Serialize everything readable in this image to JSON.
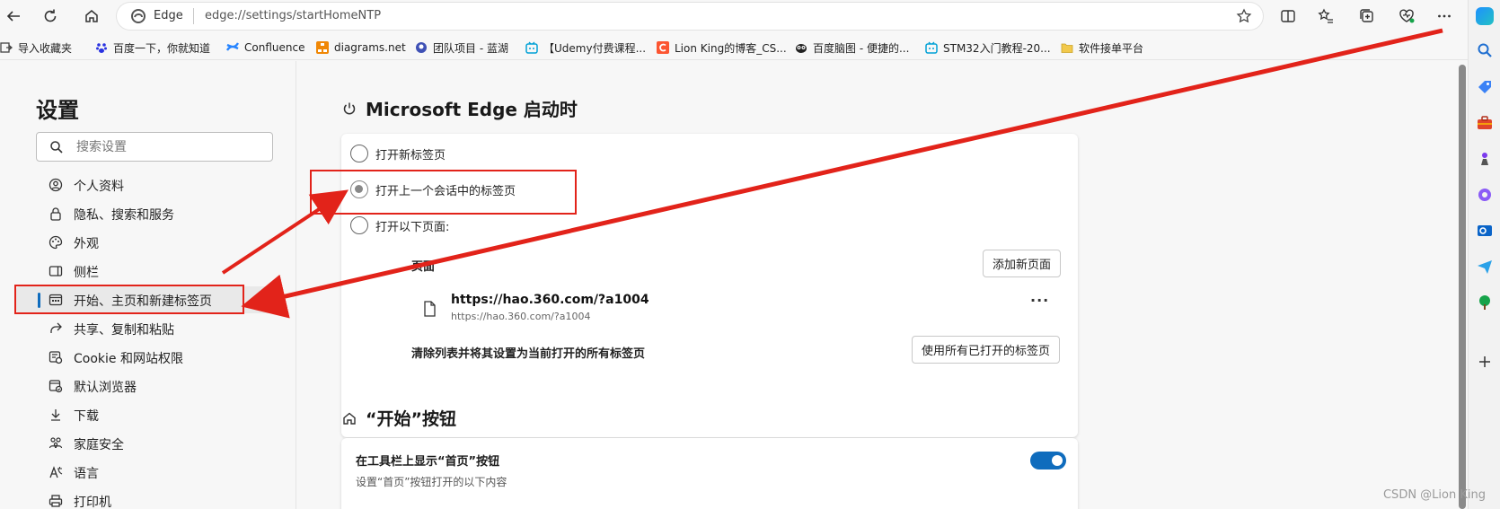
{
  "toolbar": {
    "address_site": "Edge",
    "address_url": "edge://settings/startHomeNTP"
  },
  "favorites": [
    {
      "label": "导入收藏夹",
      "icon": "import-icon",
      "color": "#444444"
    },
    {
      "label": "百度一下，你就知道",
      "icon": "baidu-icon",
      "color": "#2932e1"
    },
    {
      "label": "Confluence",
      "icon": "confluence-icon",
      "color": "#2684ff"
    },
    {
      "label": "diagrams.net",
      "icon": "diagrams-icon",
      "color": "#f08705"
    },
    {
      "label": "团队项目 - 蓝湖",
      "icon": "lanhu-icon",
      "color": "#3f51b5"
    },
    {
      "label": "【Udemy付费课程...",
      "icon": "bilibili-icon",
      "color": "#00a1d6"
    },
    {
      "label": "Lion King的博客_CS...",
      "icon": "csdn-icon",
      "color": "#fc5531"
    },
    {
      "label": "百度脑图 - 便捷的...",
      "icon": "owl-icon",
      "color": "#222222"
    },
    {
      "label": "STM32入门教程-20...",
      "icon": "bilibili-icon",
      "color": "#00a1d6"
    },
    {
      "label": "软件接单平台",
      "icon": "folder-icon",
      "color": "#f2c94c"
    }
  ],
  "nav": {
    "title": "设置",
    "search_placeholder": "搜索设置",
    "items": [
      {
        "label": "个人资料",
        "icon": "profile-icon"
      },
      {
        "label": "隐私、搜索和服务",
        "icon": "lock-icon"
      },
      {
        "label": "外观",
        "icon": "palette-icon"
      },
      {
        "label": "侧栏",
        "icon": "sidebar-icon"
      },
      {
        "label": "开始、主页和新建标签页",
        "icon": "home-grid-icon",
        "active": true
      },
      {
        "label": "共享、复制和粘贴",
        "icon": "share-icon"
      },
      {
        "label": "Cookie 和网站权限",
        "icon": "cookie-icon"
      },
      {
        "label": "默认浏览器",
        "icon": "browser-icon"
      },
      {
        "label": "下载",
        "icon": "download-icon"
      },
      {
        "label": "家庭安全",
        "icon": "family-icon"
      },
      {
        "label": "语言",
        "icon": "language-icon"
      },
      {
        "label": "打印机",
        "icon": "printer-icon"
      }
    ]
  },
  "startup": {
    "heading": "Microsoft Edge 启动时",
    "option_new_tab": "打开新标签页",
    "option_previous": "打开上一个会话中的标签页",
    "option_pages": "打开以下页面:",
    "selected_option": "打开上一个会话中的标签页",
    "pages_column": "页面",
    "add_page_button": "添加新页面",
    "page_title": "https://hao.360.com/?a1004",
    "page_url": "https://hao.360.com/?a1004",
    "more_label": "···",
    "clear_text": "清除列表并将其设置为当前打开的所有标签页",
    "use_all_button": "使用所有已打开的标签页"
  },
  "home_button": {
    "heading": "“开始”按钮",
    "row_title": "在工具栏上显示“首页”按钮",
    "row_desc": "设置“首页”按钮打开的以下内容",
    "toggle_on": true
  },
  "annotation_color": "#e2231a",
  "accent_color": "#0f6cbd",
  "watermark": "CSDN @Lion King"
}
